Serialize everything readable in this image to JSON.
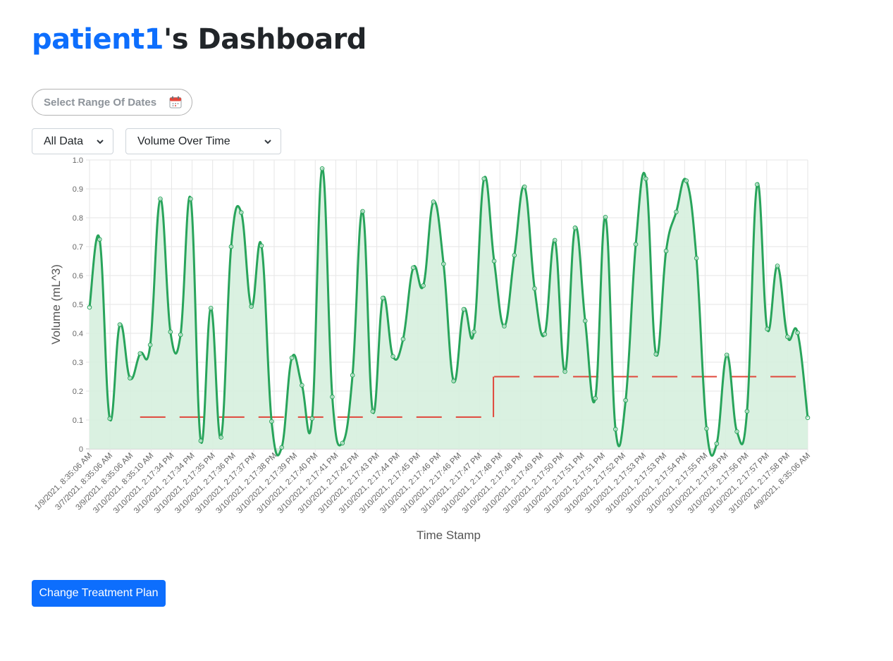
{
  "header": {
    "username": "patient1",
    "title_suffix": "'s Dashboard"
  },
  "date_picker": {
    "placeholder": "Select Range Of Dates",
    "icon": "calendar-icon"
  },
  "filters": {
    "range": {
      "selected": "All Data"
    },
    "metric": {
      "selected": "Volume Over Time"
    }
  },
  "actions": {
    "change_plan_label": "Change Treatment Plan"
  },
  "colors": {
    "accent": "#0d6efd",
    "line": "#28a45b",
    "fill": "#d6f0de",
    "threshold": "#e0473b"
  },
  "chart_data": {
    "type": "area",
    "xlabel": "Time Stamp",
    "ylabel": "Volume (mL^3)",
    "ylim": [
      0,
      1
    ],
    "yticks": [
      "0",
      "0.1",
      "0.2",
      "0.3",
      "0.4",
      "0.5",
      "0.6",
      "0.7",
      "0.8",
      "0.9",
      "1.0"
    ],
    "grid": true,
    "x_tick_labels": [
      "1/9/2021, 8:35:06 AM",
      "3/7/2021, 8:35:06 AM",
      "3/9/2021, 8:35:06 AM",
      "3/10/2021, 8:35:10 AM",
      "3/10/2021, 2:17:34 PM",
      "3/10/2021, 2:17:34 PM",
      "3/10/2021, 2:17:35 PM",
      "3/10/2021, 2:17:36 PM",
      "3/10/2021, 2:17:37 PM",
      "3/10/2021, 2:17:38 PM",
      "3/10/2021, 2:17:39 PM",
      "3/10/2021, 2:17:40 PM",
      "3/10/2021, 2:17:41 PM",
      "3/10/2021, 2:17:42 PM",
      "3/10/2021, 2:17:43 PM",
      "3/10/2021, 2:17:44 PM",
      "3/10/2021, 2:17:45 PM",
      "3/10/2021, 2:17:46 PM",
      "3/10/2021, 2:17:46 PM",
      "3/10/2021, 2:17:47 PM",
      "3/10/2021, 2:17:48 PM",
      "3/10/2021, 2:17:48 PM",
      "3/10/2021, 2:17:49 PM",
      "3/10/2021, 2:17:50 PM",
      "3/10/2021, 2:17:51 PM",
      "3/10/2021, 2:17:51 PM",
      "3/10/2021, 2:17:52 PM",
      "3/10/2021, 2:17:53 PM",
      "3/10/2021, 2:17:53 PM",
      "3/10/2021, 2:17:54 PM",
      "3/10/2021, 2:17:55 PM",
      "3/10/2021, 2:17:56 PM",
      "3/10/2021, 2:17:56 PM",
      "3/10/2021, 2:17:57 PM",
      "3/10/2021, 2:17:58 PM",
      "4/9/2021, 8:35:06 AM"
    ],
    "series": [
      {
        "values": [
          0.49,
          0.725,
          0.105,
          0.43,
          0.245,
          0.33,
          0.36,
          0.865,
          0.405,
          0.395,
          0.865,
          0.028,
          0.487,
          0.04,
          0.7,
          0.818,
          0.493,
          0.703,
          0.095,
          0.005,
          0.315,
          0.22,
          0.105,
          0.97,
          0.18,
          0.02,
          0.255,
          0.822,
          0.13,
          0.522,
          0.32,
          0.38,
          0.627,
          0.565,
          0.855,
          0.64,
          0.235,
          0.483,
          0.405,
          0.935,
          0.65,
          0.425,
          0.67,
          0.907,
          0.555,
          0.397,
          0.722,
          0.268,
          0.765,
          0.443,
          0.175,
          0.802,
          0.068,
          0.168,
          0.708,
          0.935,
          0.328,
          0.685,
          0.82,
          0.928,
          0.66,
          0.07,
          0.018,
          0.325,
          0.06,
          0.13,
          0.915,
          0.415,
          0.633,
          0.388,
          0.402,
          0.108
        ]
      },
      {
        "style": "dashed",
        "segments": [
          {
            "value": 0.11,
            "from_point": 5,
            "to_point": 39
          },
          {
            "value": 0.25,
            "from_point": 40,
            "to_point": 71
          }
        ]
      }
    ]
  }
}
